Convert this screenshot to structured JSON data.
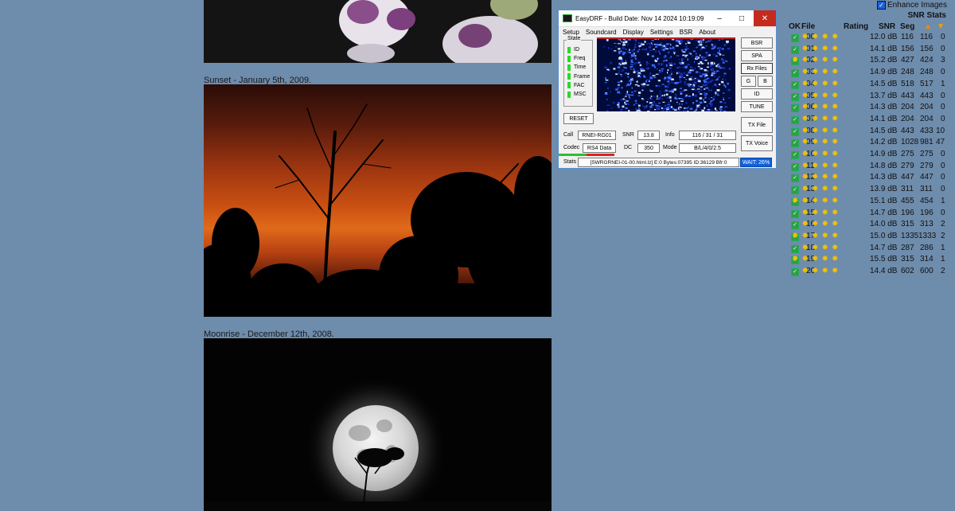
{
  "captions": {
    "sunset": "Sunset - January 5th, 2009.",
    "moonrise": "Moonrise - December 12th, 2008."
  },
  "app": {
    "title": "EasyDRF - Build Date: Nov 14 2024 10:19:09",
    "window_buttons": {
      "minimize": "–",
      "maximize": "□",
      "close": "✕"
    },
    "menu": [
      "Setup",
      "Soundcard",
      "Display",
      "Settings",
      "BSR",
      "About"
    ],
    "state": {
      "legend": "State",
      "items": [
        "ID",
        "Freq",
        "Time",
        "Frame",
        "FAC",
        "MSC"
      ],
      "led_color": "#22dd22"
    },
    "reset_label": "RESET",
    "right_buttons": [
      "BSR",
      "SPA",
      "Rx Files",
      "G",
      "B",
      "ID",
      "TUNE",
      "TX File",
      "TX Voice"
    ],
    "call_label": "Call",
    "call_value": "RNEI-RG01",
    "snr_label": "SNR",
    "snr_value": "13.8",
    "info_label": "Info",
    "info_value": "116 / 31 / 31",
    "codec_label": "Codec",
    "codec_value": "RS4 Data",
    "dc_label": "DC",
    "dc_value": "350",
    "mode_label": "Mode",
    "mode_value": "B/L/4/0/2.5",
    "stats_label": "Stats",
    "stats_value": "[SWRGRNEI-01-00.html.lz] E:0 Bytes:07395 ID:36129 Bfr:0",
    "wait_label": "WAIT: 26%"
  },
  "snr_panel": {
    "enhance_label": "Enhance Images",
    "enhance_checked": true,
    "title": "SNR Stats",
    "headers": {
      "ok": "OK",
      "file": "File",
      "rating": "Rating",
      "snr": "SNR",
      "seg": "Seg",
      "up_icon": "fire-icon",
      "down_icon": "thumbs-down-icon"
    },
    "rows": [
      {
        "file": "00",
        "stars": 4,
        "snr": "12.0 dB",
        "seg": "116",
        "c2": "116",
        "c3": "0"
      },
      {
        "file": "01",
        "stars": 4,
        "snr": "14.1 dB",
        "seg": "156",
        "c2": "156",
        "c3": "0"
      },
      {
        "file": "02",
        "stars": 5,
        "snr": "15.2 dB",
        "seg": "427",
        "c2": "424",
        "c3": "3"
      },
      {
        "file": "03",
        "stars": 4,
        "snr": "14.9 dB",
        "seg": "248",
        "c2": "248",
        "c3": "0"
      },
      {
        "file": "04",
        "stars": 4,
        "snr": "14.5 dB",
        "seg": "518",
        "c2": "517",
        "c3": "1"
      },
      {
        "file": "05",
        "stars": 4,
        "snr": "13.7 dB",
        "seg": "443",
        "c2": "443",
        "c3": "0"
      },
      {
        "file": "06",
        "stars": 4,
        "snr": "14.3 dB",
        "seg": "204",
        "c2": "204",
        "c3": "0"
      },
      {
        "file": "07",
        "stars": 4,
        "snr": "14.1 dB",
        "seg": "204",
        "c2": "204",
        "c3": "0"
      },
      {
        "file": "08",
        "stars": 4,
        "snr": "14.5 dB",
        "seg": "443",
        "c2": "433",
        "c3": "10"
      },
      {
        "file": "09",
        "stars": 4,
        "snr": "14.2 dB",
        "seg": "1028",
        "c2": "981",
        "c3": "47"
      },
      {
        "file": "10",
        "stars": 4,
        "snr": "14.9 dB",
        "seg": "275",
        "c2": "275",
        "c3": "0"
      },
      {
        "file": "11",
        "stars": 4,
        "snr": "14.8 dB",
        "seg": "279",
        "c2": "279",
        "c3": "0"
      },
      {
        "file": "12",
        "stars": 4,
        "snr": "14.3 dB",
        "seg": "447",
        "c2": "447",
        "c3": "0"
      },
      {
        "file": "13",
        "stars": 4,
        "snr": "13.9 dB",
        "seg": "311",
        "c2": "311",
        "c3": "0"
      },
      {
        "file": "14",
        "stars": 5,
        "snr": "15.1 dB",
        "seg": "455",
        "c2": "454",
        "c3": "1"
      },
      {
        "file": "15",
        "stars": 4,
        "snr": "14.7 dB",
        "seg": "196",
        "c2": "196",
        "c3": "0"
      },
      {
        "file": "16",
        "stars": 4,
        "snr": "14.0 dB",
        "seg": "315",
        "c2": "313",
        "c3": "2"
      },
      {
        "file": "17",
        "stars": 5,
        "snr": "15.0 dB",
        "seg": "1335",
        "c2": "1333",
        "c3": "2"
      },
      {
        "file": "18",
        "stars": 4,
        "snr": "14.7 dB",
        "seg": "287",
        "c2": "286",
        "c3": "1"
      },
      {
        "file": "19",
        "stars": 5,
        "snr": "15.5 dB",
        "seg": "315",
        "c2": "314",
        "c3": "1"
      },
      {
        "file": "20",
        "stars": 4,
        "snr": "14.4 dB",
        "seg": "602",
        "c2": "600",
        "c3": "2"
      }
    ]
  }
}
